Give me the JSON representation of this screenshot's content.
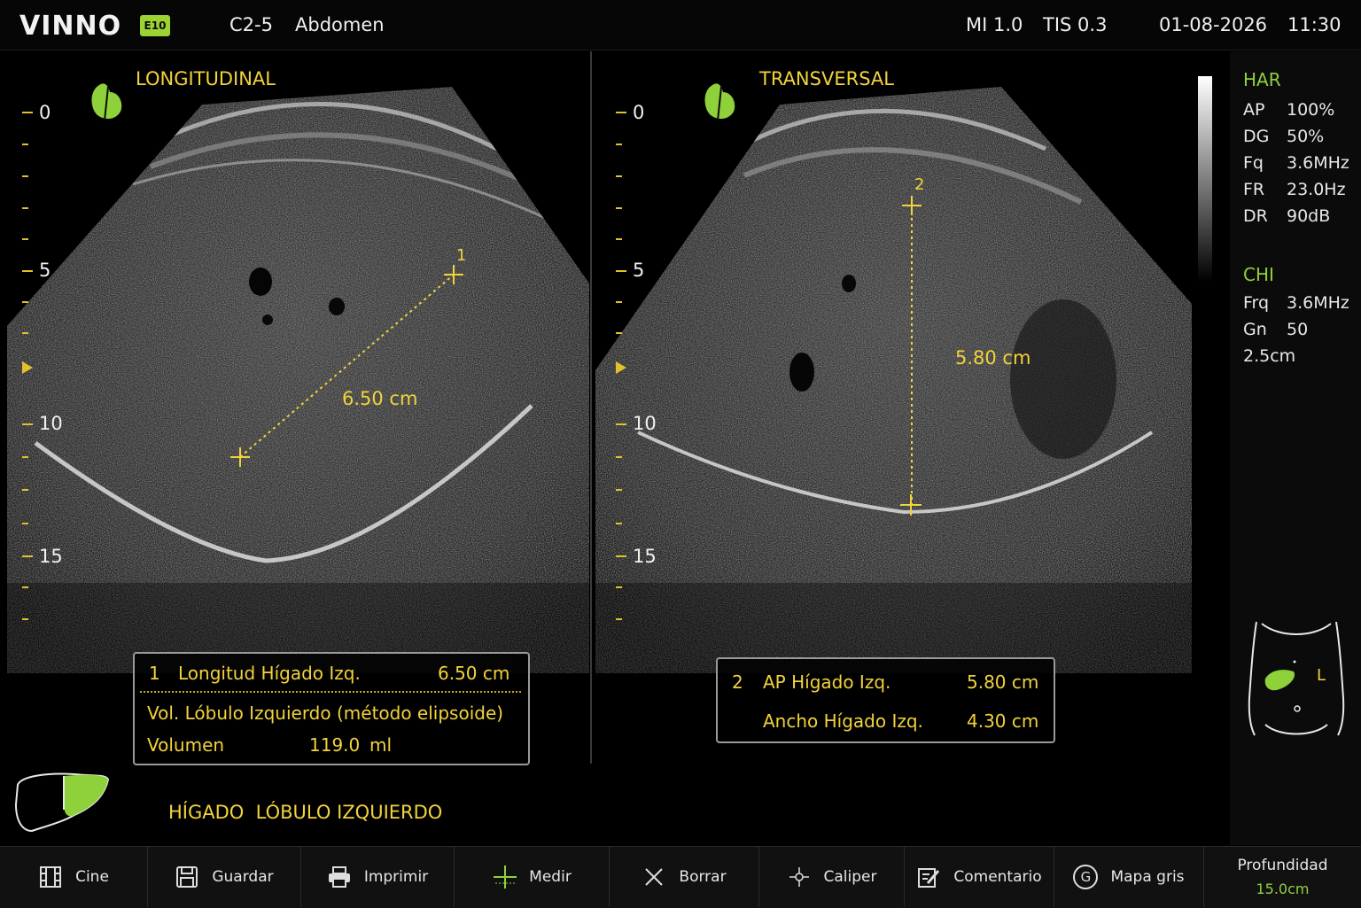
{
  "header": {
    "brand": "VINNO",
    "brand_badge": "E10",
    "probe": "C2-5",
    "preset": "Abdomen",
    "mi": "MI 1.0",
    "tis": "TIS 0.3",
    "date": "01-08-2026",
    "time": "11:30"
  },
  "left_view": {
    "title": "LONGITUDINAL",
    "scale": [
      "0",
      "5",
      "10",
      "15"
    ],
    "caliper_label": "1",
    "distance_label": "6.50 cm"
  },
  "right_view": {
    "title": "TRANSVERSAL",
    "scale": [
      "0",
      "5",
      "10",
      "15"
    ],
    "caliper_label": "2",
    "distance_label": "5.80 cm"
  },
  "measure_box_1": {
    "index": "1",
    "name": "Longitud Hígado Izq.",
    "value": "6.50 cm",
    "method": "Vol. Lóbulo Izquierdo (método elipsoide)",
    "vol_label": "Volumen",
    "vol_value": "119.0",
    "vol_unit": "ml"
  },
  "measure_box_2": {
    "index": "2",
    "row1_name": "AP Hígado Izq.",
    "row1_value": "5.80 cm",
    "row2_name": "Ancho Hígado Izq.",
    "row2_value": "4.30 cm"
  },
  "body_mark": {
    "label": "HÍGADO  LÓBULO IZQUIERDO"
  },
  "params": {
    "har_title": "HAR",
    "har": [
      {
        "k": "AP",
        "v": "100%"
      },
      {
        "k": "DG",
        "v": "50%"
      },
      {
        "k": "Fq",
        "v": "3.6MHz"
      },
      {
        "k": "FR",
        "v": "23.0Hz"
      },
      {
        "k": "DR",
        "v": "90dB"
      }
    ],
    "chi_title": "CHI",
    "chi": [
      {
        "k": "Frq",
        "v": "3.6MHz"
      },
      {
        "k": "Gn",
        "v": "50"
      }
    ],
    "chi_extra": "2.5cm",
    "torso_side": "L"
  },
  "toolbar": {
    "cine": "Cine",
    "save": "Guardar",
    "print": "Imprimir",
    "measure": "Medir",
    "erase": "Borrar",
    "caliper": "Caliper",
    "comment": "Comentario",
    "graymap_letter": "G",
    "graymap": "Mapa gris",
    "depth_label": "Profundidad",
    "depth_value": "15.0cm"
  },
  "colors": {
    "yellow": "#f2d33a",
    "green": "#8fd13a",
    "background": "#000000"
  }
}
